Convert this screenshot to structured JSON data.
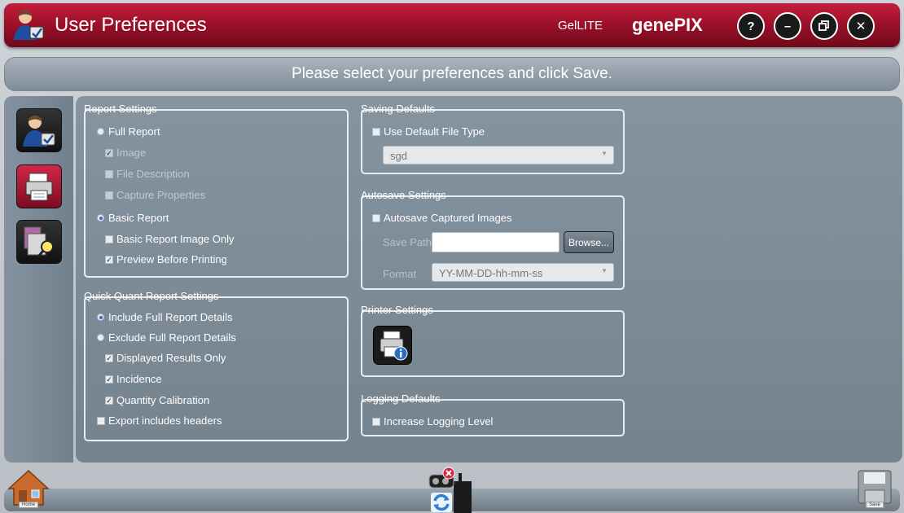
{
  "window": {
    "title": "User Preferences",
    "product": "GelLITE",
    "brand": "genePIX",
    "controls": [
      "help",
      "minimize",
      "restore",
      "close"
    ],
    "help_label": "?",
    "minimize_label": "–",
    "close_label": "✕"
  },
  "instruction": "Please select your preferences and click Save.",
  "sidebar": {
    "tabs": [
      {
        "icon": "user-settings-icon",
        "selected": false
      },
      {
        "icon": "printer-icon",
        "selected": true
      },
      {
        "icon": "search-document-icon",
        "selected": false
      }
    ]
  },
  "report_settings": {
    "label": "Report Settings",
    "full_report": "Full Report",
    "image": "Image",
    "file_description": "File Description",
    "capture_properties": "Capture Properties",
    "basic_report": "Basic Report",
    "basic_report_image_only": "Basic Report Image Only",
    "preview_before_printing": "Preview Before Printing"
  },
  "quick_quant": {
    "label": "Quick Quant Report Settings",
    "include_full": "Include Full Report Details",
    "exclude_full": "Exclude Full Report Details",
    "displayed_results_only": "Displayed Results Only",
    "incidence": "Incidence",
    "quantity_calibration": "Quantity Calibration",
    "export_headers": "Export includes headers"
  },
  "saving_defaults": {
    "label": "Saving Defaults",
    "use_default_file_type": "Use Default File Type",
    "file_type_value": "sgd"
  },
  "autosave": {
    "label": "Autosave Settings",
    "autosave_captured": "Autosave Captured Images",
    "save_path_label": "Save Path",
    "save_path_value": "",
    "browse_label": "Browse...",
    "format_label": "Format",
    "format_value": "YY-MM-DD-hh-mm-ss"
  },
  "printer_settings": {
    "label": "Printer Settings"
  },
  "logging": {
    "label": "Logging Defaults",
    "increase_logging": "Increase Logging Level"
  },
  "bottom": {
    "home_label": "Home",
    "save_label": "Save"
  },
  "colors": {
    "titlebar": "#9a1028",
    "panel": "#7f8d99",
    "radio_dot": "#2b6fc4"
  }
}
